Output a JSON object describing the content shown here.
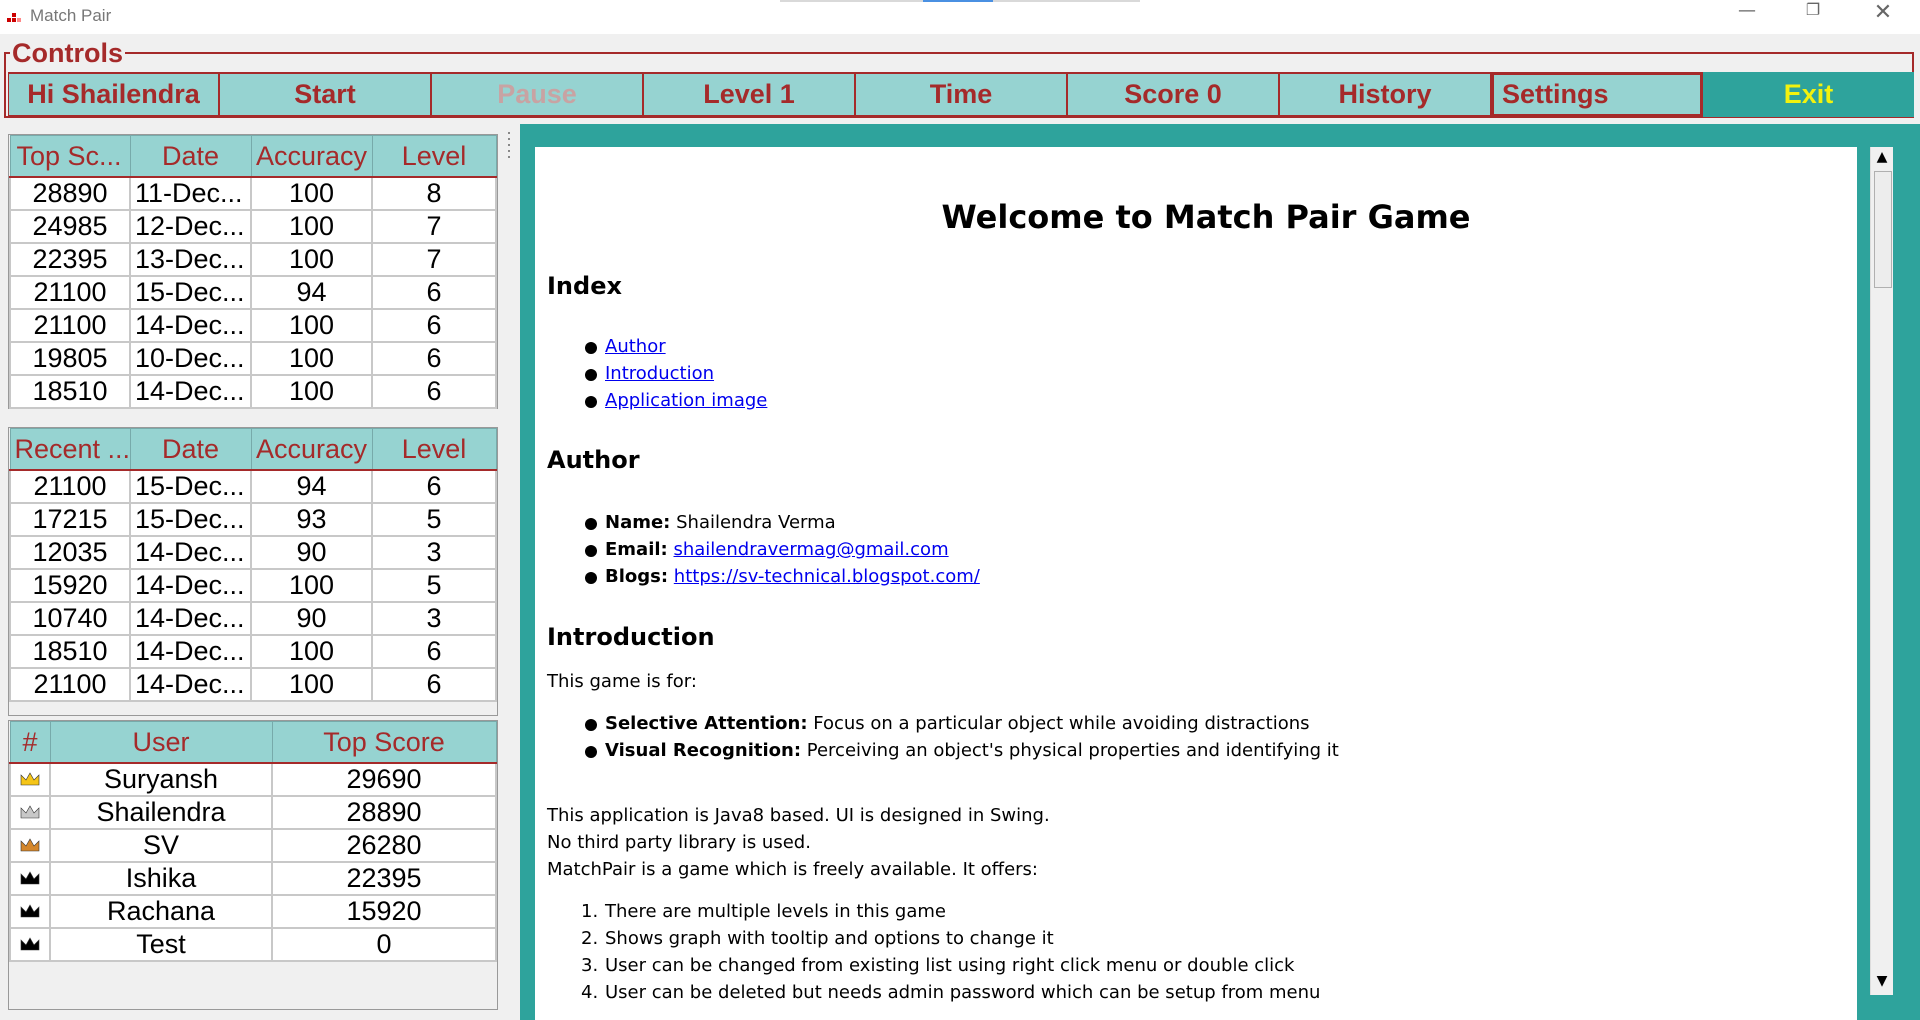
{
  "window": {
    "title": "Match Pair"
  },
  "controls": {
    "legend": "Controls",
    "buttons": [
      {
        "label": "Hi Shailendra",
        "state": "normal"
      },
      {
        "label": "Start",
        "state": "normal"
      },
      {
        "label": "Pause",
        "state": "disabled"
      },
      {
        "label": "Level 1",
        "state": "normal"
      },
      {
        "label": "Time",
        "state": "normal"
      },
      {
        "label": "Score 0",
        "state": "normal"
      },
      {
        "label": "History",
        "state": "normal"
      },
      {
        "label": "Settings",
        "state": "focused"
      },
      {
        "label": "Exit",
        "state": "normal"
      }
    ]
  },
  "top_scores": {
    "headers": [
      "Top Sc...",
      "Date",
      "Accuracy",
      "Level"
    ],
    "rows": [
      [
        "28890",
        "11-Dec...",
        "100",
        "8"
      ],
      [
        "24985",
        "12-Dec...",
        "100",
        "7"
      ],
      [
        "22395",
        "13-Dec...",
        "100",
        "7"
      ],
      [
        "21100",
        "15-Dec...",
        "94",
        "6"
      ],
      [
        "21100",
        "14-Dec...",
        "100",
        "6"
      ],
      [
        "19805",
        "10-Dec...",
        "100",
        "6"
      ],
      [
        "18510",
        "14-Dec...",
        "100",
        "6"
      ]
    ]
  },
  "recent_scores": {
    "headers": [
      "Recent ...",
      "Date",
      "Accuracy",
      "Level"
    ],
    "rows": [
      [
        "21100",
        "15-Dec...",
        "94",
        "6"
      ],
      [
        "17215",
        "15-Dec...",
        "93",
        "5"
      ],
      [
        "12035",
        "14-Dec...",
        "90",
        "3"
      ],
      [
        "15920",
        "14-Dec...",
        "100",
        "5"
      ],
      [
        "10740",
        "14-Dec...",
        "90",
        "3"
      ],
      [
        "18510",
        "14-Dec...",
        "100",
        "6"
      ],
      [
        "21100",
        "14-Dec...",
        "100",
        "6"
      ]
    ]
  },
  "users": {
    "headers": [
      "#",
      "User",
      "Top Score"
    ],
    "rows": [
      {
        "crown": "gold",
        "user": "Suryansh",
        "score": "29690"
      },
      {
        "crown": "silver",
        "user": "Shailendra",
        "score": "28890"
      },
      {
        "crown": "bronze",
        "user": "SV",
        "score": "26280"
      },
      {
        "crown": "black",
        "user": "Ishika",
        "score": "22395"
      },
      {
        "crown": "black",
        "user": "Rachana",
        "score": "15920"
      },
      {
        "crown": "black",
        "user": "Test",
        "score": "0"
      }
    ],
    "crown_colors": {
      "gold": "#f5c518",
      "silver": "#c8c8c8",
      "bronze": "#d4862a",
      "black": "#000000"
    }
  },
  "content": {
    "title": "Welcome to Match Pair Game",
    "index_heading": "Index",
    "index_links": [
      "Author",
      "Introduction",
      "Application image"
    ],
    "author_heading": "Author",
    "author": {
      "name_label": "Name:",
      "name": "Shailendra Verma",
      "email_label": "Email:",
      "email": "shailendravermag@gmail.com",
      "blogs_label": "Blogs:",
      "blogs": "https://sv-technical.blogspot.com/"
    },
    "intro_heading": "Introduction",
    "intro_text": "This game is for:",
    "intro_items": [
      {
        "label": "Selective Attention:",
        "text": "Focus on a particular object while avoiding distractions"
      },
      {
        "label": "Visual Recognition:",
        "text": "Perceiving an object's physical properties and identifying it"
      }
    ],
    "para": [
      "This application is Java8 based. UI is designed in Swing.",
      "No third party library is used.",
      "MatchPair is a game which is freely available. It offers:"
    ],
    "features": [
      "There are multiple levels in this game",
      "Shows graph with tooltip and options to change it",
      "User can be changed from existing list using right click menu or double click",
      "User can be deleted but needs admin password which can be setup from menu"
    ]
  },
  "colors": {
    "accent": "#a52a2a",
    "teal": "#96d3d1",
    "dark_teal": "#2ea39c",
    "exit_text": "#f2f20e"
  }
}
